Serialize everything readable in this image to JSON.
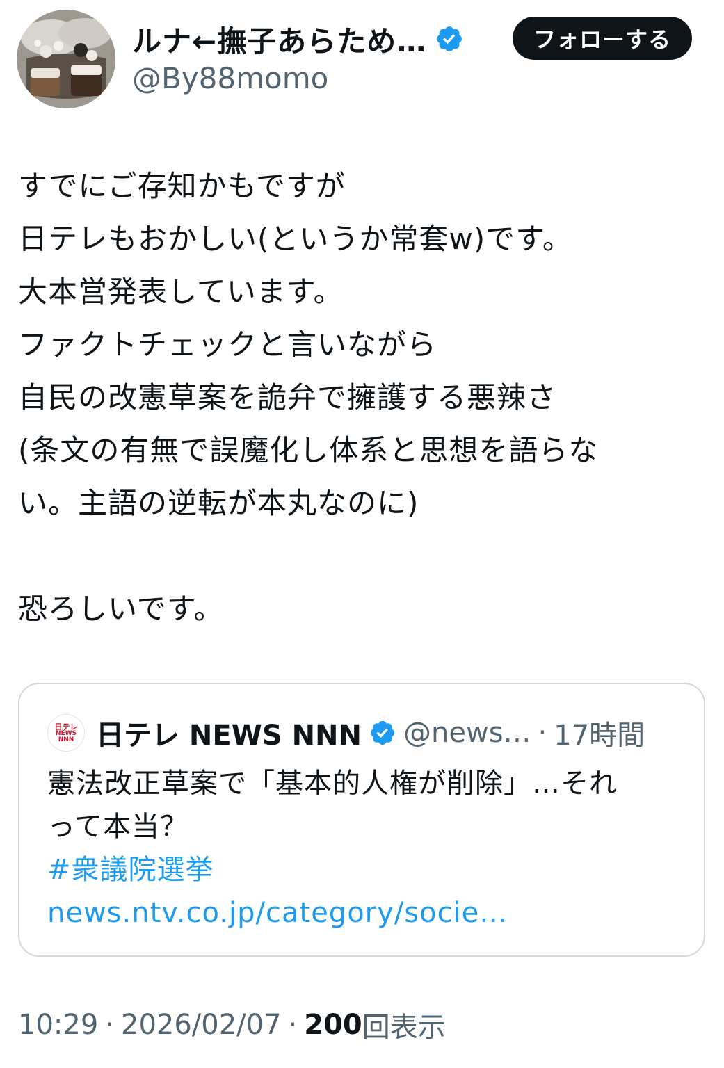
{
  "author": {
    "display_name": "ルナ←撫子あらため…",
    "handle": "@By88momo",
    "verified_icon": "verified-badge-icon",
    "follow_label": "フォローする"
  },
  "tweet": {
    "lines": [
      "すでにご存知かもですが",
      "日テレもおかしい(というか常套w)です。",
      "大本営発表しています。",
      "ファクトチェックと言いながら",
      "自民の改憲草案を詭弁で擁護する悪辣さ",
      "(条文の有無で誤魔化し体系と思想を語らな",
      "い。主語の逆転が本丸なのに)",
      "",
      "恐ろしいです。"
    ]
  },
  "quote": {
    "logo_text": [
      "日テレ",
      "NEWS",
      "NNN"
    ],
    "name": "日テレ NEWS NNN",
    "handle": "@news…",
    "separator": "·",
    "time": "17時間",
    "text_lines": [
      "憲法改正草案で「基本的人権が削除」…それ",
      "って本当？"
    ],
    "hashtag": "#衆議院選挙",
    "link": "news.ntv.co.jp/category/socie…"
  },
  "meta": {
    "time": "10:29",
    "separator": "·",
    "date": "2026/02/07",
    "views_count": "200",
    "views_label": "回表示"
  },
  "colors": {
    "accent": "#1d9bf0",
    "text": "#0f1419",
    "secondary": "#536471",
    "ntv_red": "#d7132c"
  }
}
